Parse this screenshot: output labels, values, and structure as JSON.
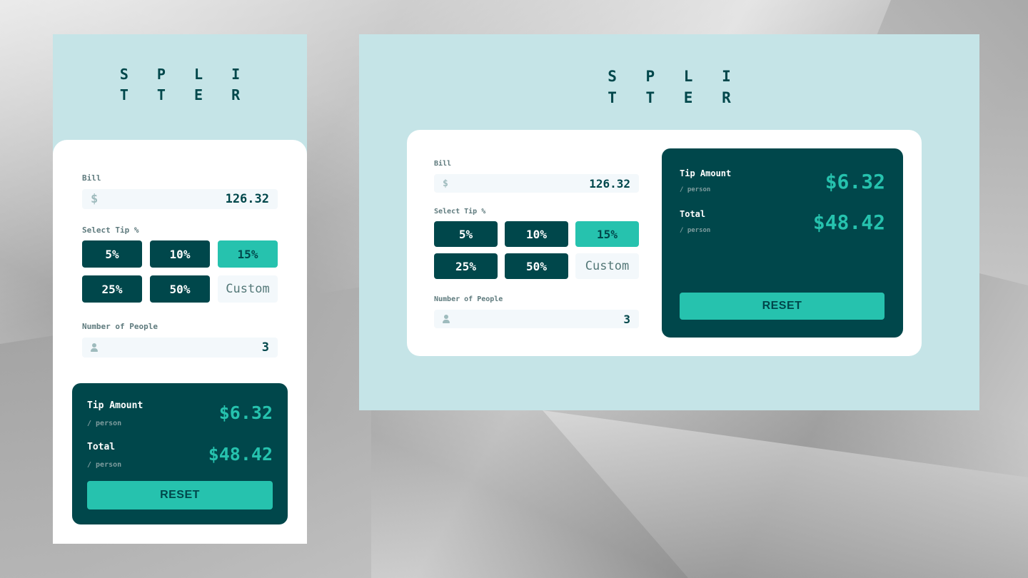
{
  "app": {
    "logo_line1": "S P L I",
    "logo_line2": "T T E R"
  },
  "form": {
    "bill_label": "Bill",
    "currency_icon": "dollar-icon",
    "currency_symbol": "$",
    "bill_value": "126.32",
    "tip_label": "Select Tip %",
    "tips": [
      {
        "label": "5%",
        "selected": false
      },
      {
        "label": "10%",
        "selected": false
      },
      {
        "label": "15%",
        "selected": true
      },
      {
        "label": "25%",
        "selected": false
      },
      {
        "label": "50%",
        "selected": false
      }
    ],
    "custom_placeholder": "Custom",
    "people_label": "Number of People",
    "people_icon": "person-icon",
    "people_value": "3"
  },
  "results": {
    "tip_amount_label": "Tip Amount",
    "tip_amount_sub": "/ person",
    "tip_amount_value": "$6.32",
    "total_label": "Total",
    "total_sub": "/ person",
    "total_value": "$48.42",
    "reset_label": "RESET"
  },
  "colors": {
    "dark_cyan": "#00474b",
    "strong_cyan": "#26c2ae",
    "light_cyan": "#c5e4e7",
    "input_bg": "#f3f8fb"
  }
}
